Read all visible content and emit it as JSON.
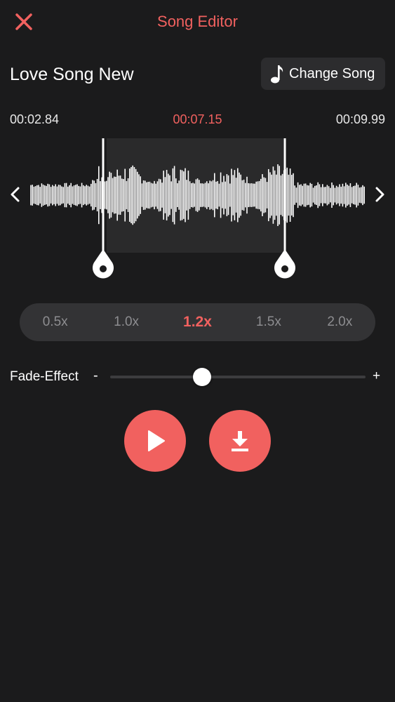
{
  "header": {
    "title": "Song Editor",
    "close_icon": "close-icon"
  },
  "song": {
    "name": "Love Song New",
    "change_label": "Change Song",
    "change_icon": "music-note-icon"
  },
  "times": {
    "start": "00:02.84",
    "current": "00:07.15",
    "end": "00:09.99"
  },
  "speed": {
    "options": [
      "0.5x",
      "1.0x",
      "1.2x",
      "1.5x",
      "2.0x"
    ],
    "selected": "1.2x"
  },
  "fade": {
    "label": "Fade-Effect",
    "minus": "-",
    "plus": "+",
    "value": 0.36
  },
  "actions": {
    "play_icon": "play-icon",
    "download_icon": "download-icon"
  },
  "colors": {
    "accent": "#f1615f",
    "background": "#1b1b1c",
    "panel": "#333335",
    "button_bg": "#2c2c2e",
    "inactive_text": "#8d8d90"
  }
}
